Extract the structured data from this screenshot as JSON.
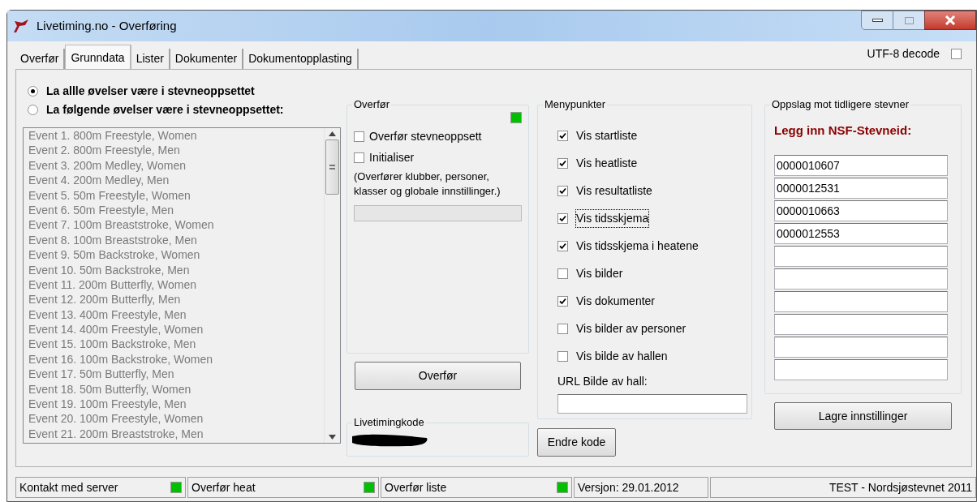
{
  "window": {
    "title": "Livetiming.no - Overføring"
  },
  "tabs": [
    {
      "label": "Overfør",
      "selected": false
    },
    {
      "label": "Grunndata",
      "selected": true
    },
    {
      "label": "Lister",
      "selected": false
    },
    {
      "label": "Dokumenter",
      "selected": false
    },
    {
      "label": "Dokumentopplasting",
      "selected": false
    }
  ],
  "utf8_decode": {
    "label": "UTF-8 decode",
    "checked": false
  },
  "event_scope": [
    {
      "label": "La allle øvelser være i stevneoppsettet",
      "selected": true
    },
    {
      "label": "La følgende øvelser være i stevneoppsettet:",
      "selected": false
    }
  ],
  "events": [
    "Event 1. 800m Freestyle, Women",
    "Event 2. 800m Freestyle, Men",
    "Event 3. 200m Medley, Women",
    "Event 4. 200m Medley, Men",
    "Event 5. 50m Freestyle, Women",
    "Event 6. 50m Freestyle, Men",
    "Event 7. 100m Breaststroke, Women",
    "Event 8. 100m Breaststroke, Men",
    "Event 9. 50m Backstroke, Women",
    "Event 10. 50m Backstroke, Men",
    "Event 11. 200m Butterfly, Women",
    "Event 12. 200m Butterfly, Men",
    "Event 13. 400m Freestyle, Men",
    "Event 14. 400m Freestyle, Women",
    "Event 15. 100m Backstroke, Men",
    "Event 16. 100m Backstroke, Women",
    "Event 17. 50m Butterfly, Men",
    "Event 18. 50m Butterfly, Women",
    "Event 19. 100m Freestyle, Men",
    "Event 20. 100m Freestyle, Women",
    "Event 21. 200m Breaststroke, Men"
  ],
  "transfer": {
    "title": "Overfør",
    "lamp_on": true,
    "options": [
      {
        "label": "Overfør stevneoppsett",
        "checked": false
      },
      {
        "label": "Initialiser",
        "checked": false
      }
    ],
    "note": "(Overfører klubber, personer, klasser og globale innstillinger.)",
    "button": "Overfør"
  },
  "livetimingkode": {
    "title": "Livetimingkode"
  },
  "menu_items": {
    "title": "Menypunkter",
    "items": [
      {
        "label": "Vis startliste",
        "checked": true,
        "focused": false
      },
      {
        "label": "Vis heatliste",
        "checked": true,
        "focused": false
      },
      {
        "label": "Vis resultatliste",
        "checked": true,
        "focused": false
      },
      {
        "label": "Vis tidsskjema",
        "checked": true,
        "focused": true
      },
      {
        "label": "Vis tidsskjema i heatene",
        "checked": true,
        "focused": false
      },
      {
        "label": "Vis bilder",
        "checked": false,
        "focused": false
      },
      {
        "label": "Vis dokumenter",
        "checked": true,
        "focused": false
      },
      {
        "label": "Vis bilder av personer",
        "checked": false,
        "focused": false
      },
      {
        "label": "Vis bilde av hallen",
        "checked": false,
        "focused": false
      }
    ],
    "url_label": "URL Bilde av hall:"
  },
  "change_code_button": "Endre kode",
  "lookup": {
    "title": "Oppslag mot tidligere stevner",
    "heading": "Legg inn NSF-Stevneid:",
    "ids": [
      "0000010607",
      "0000012531",
      "0000010663",
      "0000012553"
    ],
    "button": "Lagre innstillinger"
  },
  "status_bar": [
    {
      "text": "Kontakt med server",
      "lamp_on": true
    },
    {
      "text": "Overfør heat",
      "lamp_on": true
    },
    {
      "text": "Overfør liste",
      "lamp_on": true
    },
    {
      "text": "Versjon: 29.01.2012"
    },
    {
      "text": "TEST - Nordsjøstevnet 2011"
    }
  ]
}
